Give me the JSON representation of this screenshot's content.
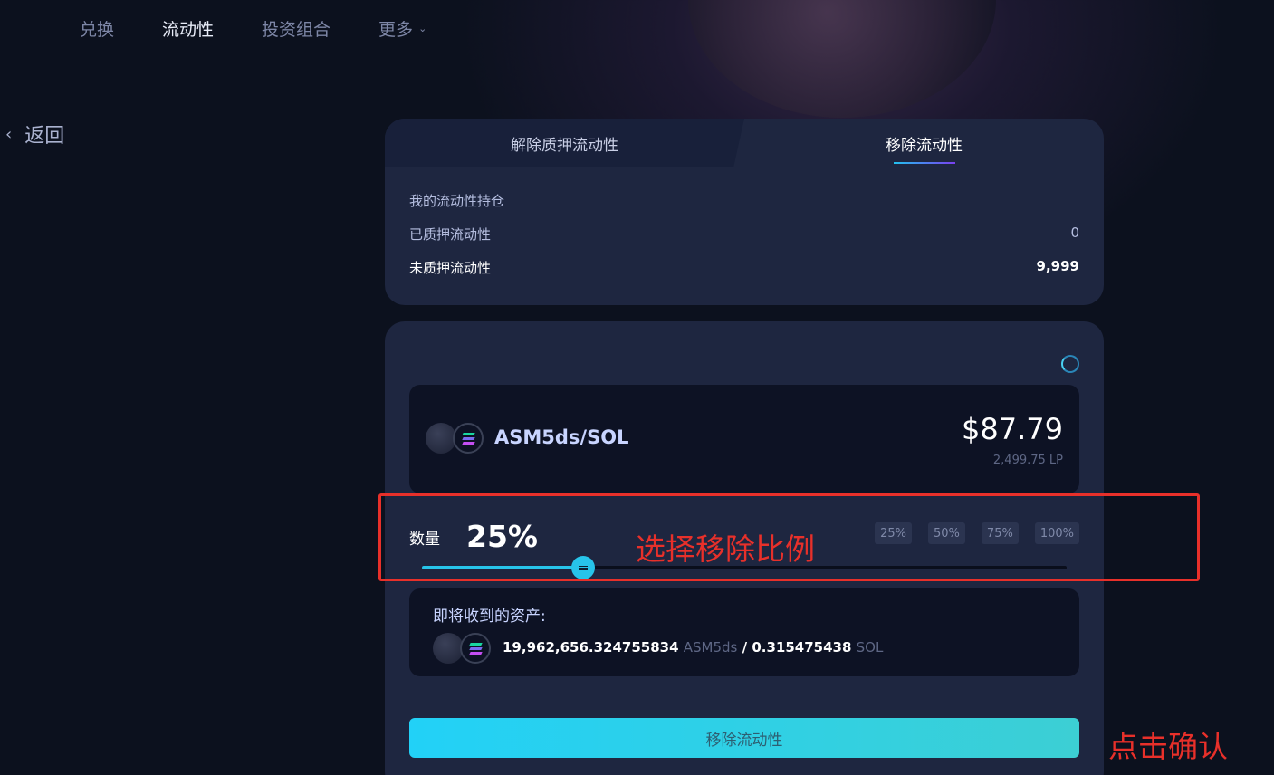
{
  "nav": {
    "items": [
      {
        "label": "兑换",
        "active": false
      },
      {
        "label": "流动性",
        "active": true
      },
      {
        "label": "投资组合",
        "active": false
      },
      {
        "label": "更多",
        "active": false,
        "icon": "chevron-down-icon"
      }
    ]
  },
  "back": {
    "label": "返回",
    "icon": "chevron-left-icon"
  },
  "tabs": {
    "unstake": "解除质押流动性",
    "remove": "移除流动性",
    "active": "remove"
  },
  "holdings": {
    "title": "我的流动性持仓",
    "staked_label": "已质押流动性",
    "staked_value": "0",
    "unstaked_label": "未质押流动性",
    "unstaked_value": "9,999"
  },
  "pool": {
    "name": "ASM5ds/SOL",
    "usd_value": "$87.79",
    "lp_amount": "2,499.75 LP"
  },
  "amount": {
    "label": "数量",
    "percent_text": "25%",
    "percent": 25,
    "presets": [
      "25%",
      "50%",
      "75%",
      "100%"
    ]
  },
  "receive": {
    "title": "即将收到的资产:",
    "amount_a": "19,962,656.324755834",
    "token_a": "ASM5ds",
    "separator": "/",
    "amount_b": "0.315475438",
    "token_b": "SOL"
  },
  "confirm_button": "移除流动性",
  "annotations": {
    "slider_note": "选择移除比例",
    "confirm_note": "点击确认"
  },
  "colors": {
    "accent": "#27c4ea",
    "annotation": "#e8302a",
    "card_bg": "#1e2640"
  }
}
